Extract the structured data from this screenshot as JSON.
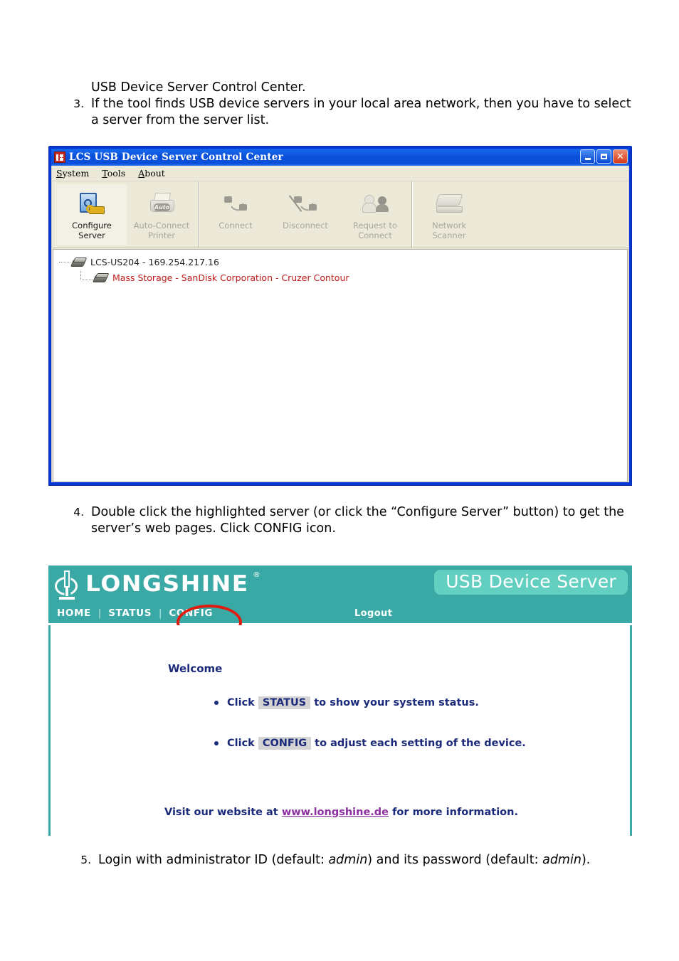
{
  "document": {
    "lead_line": "USB Device Server Control Center.",
    "steps": [
      {
        "number": "3.",
        "text": "If the tool finds USB device servers in your local area network, then you have to select a server from the server list."
      },
      {
        "number": "4.",
        "text": "Double click the highlighted server (or click the “Configure Server” button) to get the server’s web pages. Click CONFIG icon."
      },
      {
        "number": "5.",
        "prefix": "Login with administrator ID (default: ",
        "italic1": "admin",
        "middle": ") and its password (default: ",
        "italic2": "admin",
        "suffix": ")."
      }
    ]
  },
  "app_window": {
    "title": "LCS USB Device Server Control Center",
    "icon": "app-logo-icon",
    "window_controls": {
      "minimize": "minimize-icon",
      "maximize": "maximize-icon",
      "close": "close-icon"
    },
    "menus": [
      {
        "label": "System",
        "accel": "S",
        "rest": "ystem"
      },
      {
        "label": "Tools",
        "accel": "T",
        "rest": "ools"
      },
      {
        "label": "About",
        "accel": "A",
        "rest": "bout"
      }
    ],
    "toolbar": {
      "groups": [
        {
          "buttons": [
            {
              "line1": "Configure",
              "line2": "Server",
              "icon": "configure-server-icon",
              "enabled": true
            },
            {
              "line1": "Auto-Connect",
              "line2": "Printer",
              "icon": "auto-connect-printer-icon",
              "enabled": false
            }
          ]
        },
        {
          "buttons": [
            {
              "line1": "Connect",
              "line2": "",
              "icon": "connect-icon",
              "enabled": false
            },
            {
              "line1": "Disconnect",
              "line2": "",
              "icon": "disconnect-icon",
              "enabled": false
            },
            {
              "line1": "Request to",
              "line2": "Connect",
              "icon": "request-to-connect-icon",
              "enabled": false
            }
          ]
        },
        {
          "buttons": [
            {
              "line1": "Network",
              "line2": "Scanner",
              "icon": "network-scanner-icon",
              "enabled": false
            }
          ]
        }
      ]
    },
    "server_tree": [
      {
        "label": "LCS-US204 - 169.254.217.16",
        "level": 0,
        "color": "#232323",
        "icon": "server-device-icon"
      },
      {
        "label": "Mass Storage - SanDisk Corporation - Cruzer Contour",
        "level": 1,
        "color": "#c01a1a",
        "icon": "usb-device-icon"
      }
    ]
  },
  "web_page": {
    "brand": "LONGSHINE",
    "brand_registered": "®",
    "product_badge": "USB Device Server",
    "nav": {
      "items": [
        "HOME",
        "STATUS",
        "CONFIG"
      ],
      "separator": "|",
      "logout": "Logout",
      "highlighted": "CONFIG"
    },
    "content": {
      "welcome_title": "Welcome",
      "bullets": [
        {
          "pre": "Click",
          "highlight": "STATUS",
          "post": "to show your system status."
        },
        {
          "pre": "Click",
          "highlight": "CONFIG",
          "post": "to adjust each setting of the device."
        }
      ],
      "visit": {
        "pre": "Visit our website at",
        "link": "www.longshine.de",
        "post": "for more information."
      }
    }
  },
  "colors": {
    "brand_teal": "#3aa9a5",
    "badge_teal": "#62cfc0",
    "nav_text": "#ffffff",
    "annotation_red": "#e01b10",
    "web_text_navy": "#1b2a7a",
    "link_purple": "#8d2fa0",
    "device_red": "#c01a1a",
    "titlebar_blue": "#0a4fd8"
  }
}
